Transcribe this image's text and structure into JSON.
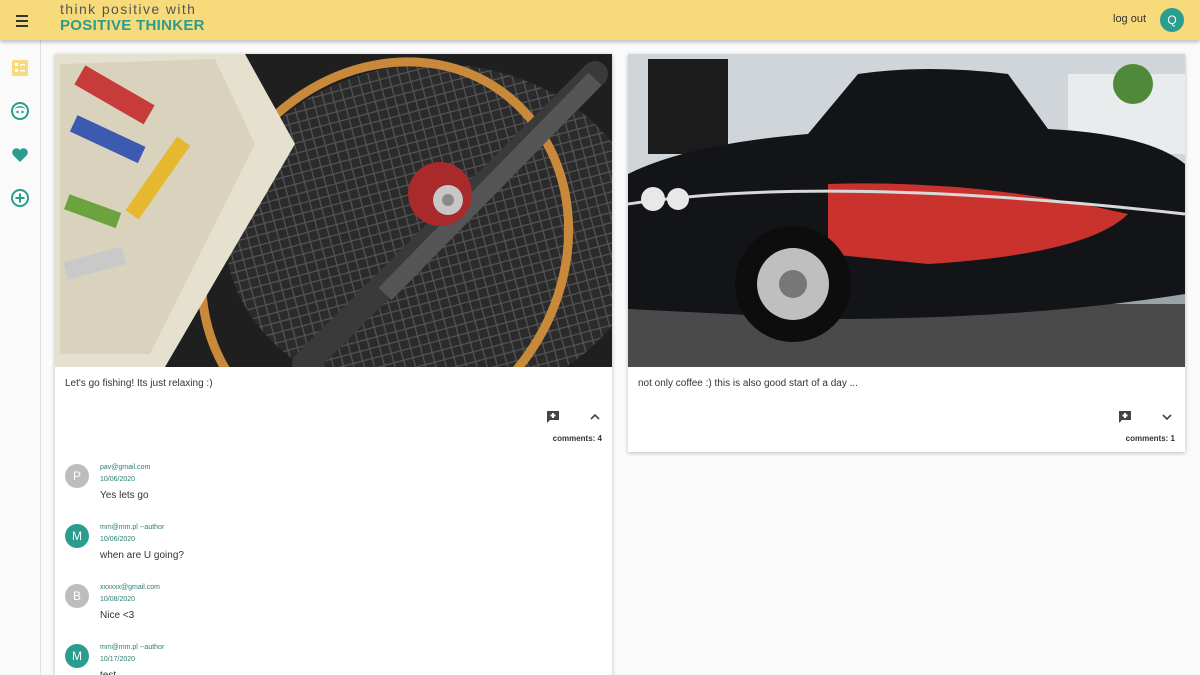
{
  "header": {
    "brand_line1": "think positive with",
    "brand_line2": "POSITIVE THINKER",
    "logout_label": "log out",
    "user_initial": "Q",
    "icon": "menu-icon"
  },
  "colors": {
    "header_bg": "#f7da7a",
    "accent": "#2a9d8f",
    "muted_avatar": "#bdbdbd"
  },
  "sidebar": {
    "items": [
      {
        "icon": "posts-list-icon",
        "active": true
      },
      {
        "icon": "profile-face-icon"
      },
      {
        "icon": "heart-icon"
      },
      {
        "icon": "add-circle-icon"
      }
    ]
  },
  "posts": [
    {
      "image": "fishing rod with reel, landing net and tackle box",
      "text": "Let's go fishing! Its just relaxing :)",
      "comments_label": "comments: 4",
      "expanded": true,
      "comments": [
        {
          "initial": "P",
          "author": "pav@gmail.com",
          "date": "10/06/2020",
          "text": "Yes lets go",
          "color": "#bdbdbd"
        },
        {
          "initial": "M",
          "author": "mm@mm.pl --author",
          "date": "10/06/2020",
          "text": "when are U going?",
          "color": "#2a9d8f"
        },
        {
          "initial": "B",
          "author": "xxxxxx@gmail.com",
          "date": "10/08/2020",
          "text": "Nice <3",
          "color": "#bdbdbd"
        },
        {
          "initial": "M",
          "author": "mm@mm.pl --author",
          "date": "10/17/2020",
          "text": "test",
          "color": "#2a9d8f"
        }
      ]
    },
    {
      "image": "black and red vintage convertible car",
      "text": "not only coffee :) this is also good start of a day ...",
      "comments_label": "comments: 1",
      "expanded": false,
      "comments": []
    }
  ]
}
